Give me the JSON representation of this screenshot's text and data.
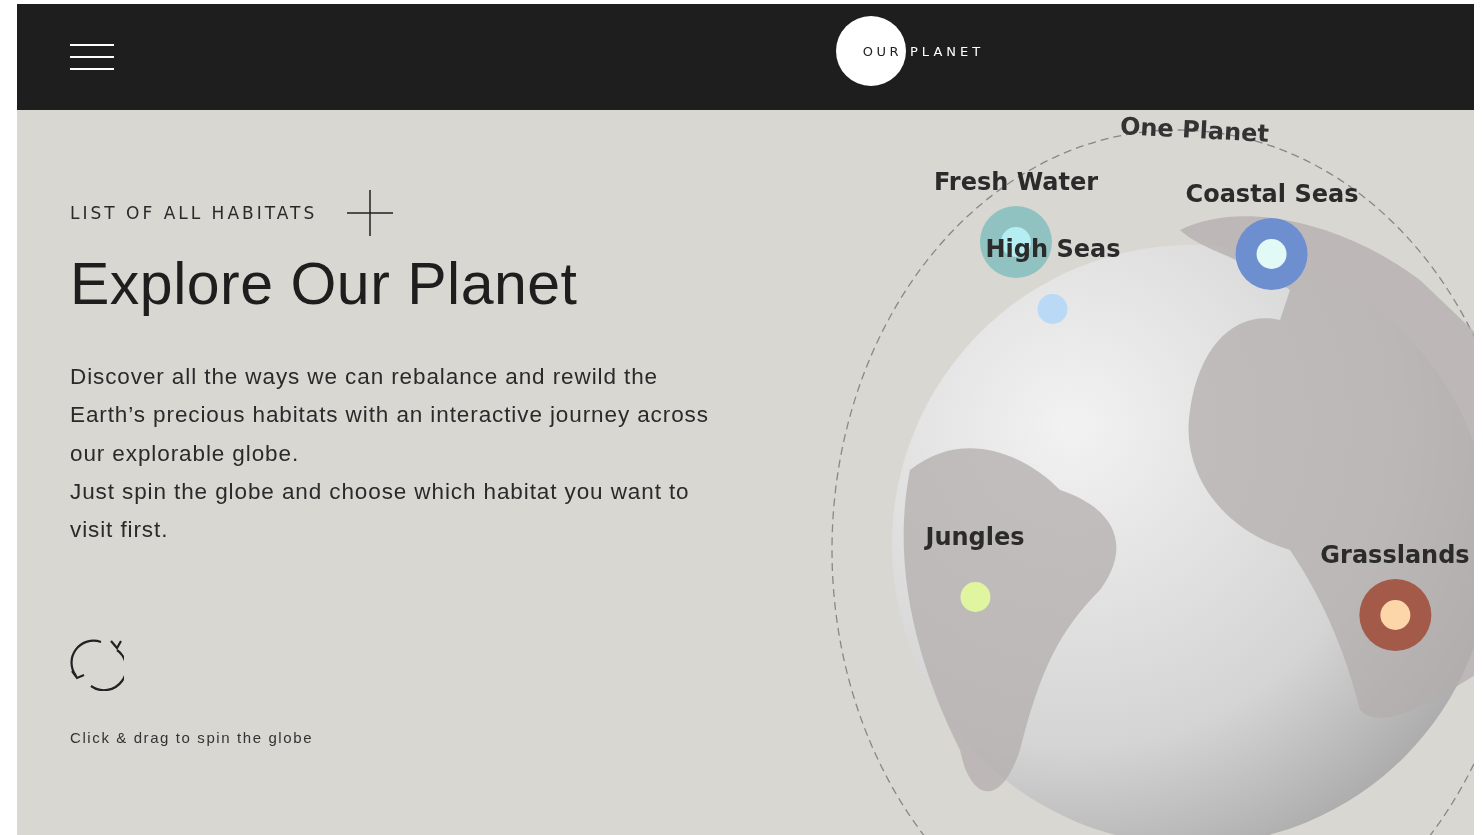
{
  "header": {
    "logo_left": "OUR",
    "logo_right": "PLANET"
  },
  "intro": {
    "list_link": "LIST OF ALL HABITATS",
    "title": "Explore Our Planet",
    "paragraphs": [
      "Discover all the ways we can rebalance and rewild the Earth’s precious habitats with an interactive journey across our explorable globe.",
      "Just spin the globe and choose which habitat you want to visit first."
    ],
    "hint": "Click & drag to spin the globe"
  },
  "globe": {
    "ring_label": "One Planet",
    "habitats": [
      {
        "name": "Fresh Water",
        "color": "#b4eef2",
        "halo": {
          "color": "#8fc2c0"
        }
      },
      {
        "name": "High Seas",
        "color": "#b9d9f7"
      },
      {
        "name": "Coastal Seas",
        "color": "#e2faf6",
        "halo": {
          "color": "#6d8fcf"
        }
      },
      {
        "name": "Jungles",
        "color": "#dff59f"
      },
      {
        "name": "Grasslands",
        "color": "#fcd6a8",
        "halo": {
          "color": "#a35a48"
        }
      }
    ]
  }
}
